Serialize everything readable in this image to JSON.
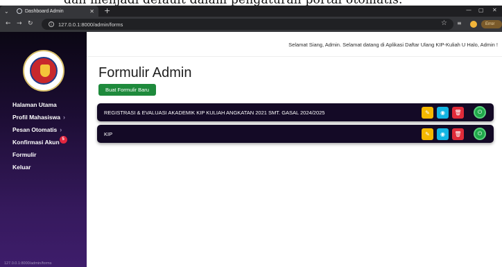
{
  "caption_fragment": "dan menjadi default dalam pengaturan portal otomatis.",
  "browser": {
    "tab_title": "Dashboard Admin",
    "url": "127.0.0.1:8000/admin/forms",
    "error_label": "Error"
  },
  "sidebar": {
    "items": [
      {
        "label": "Halaman Utama",
        "chevron": false
      },
      {
        "label": "Profil Mahasiswa",
        "chevron": true
      },
      {
        "label": "Pesan Otomatis",
        "chevron": true
      },
      {
        "label": "Konfirmasi Akun",
        "chevron": false,
        "badge": "5"
      },
      {
        "label": "Formulir",
        "chevron": false
      },
      {
        "label": "Keluar",
        "chevron": false
      }
    ],
    "status_url": "127.0.0.1:8000/admin/forms"
  },
  "header": {
    "greeting": "Selamat Siang, Admin. Selamat datang di Aplikasi Daftar Ulang KIP-Kuliah U Halo, Admin !"
  },
  "main": {
    "title": "Formulir Admin",
    "new_form_button": "Buat Formulir Baru",
    "forms": [
      {
        "name": "REGISTRASI & EVALUASI AKADEMIK KIP KULIAH ANGKATAN 2021 SMT. GASAL 2024/2025"
      },
      {
        "name": "KIP"
      }
    ]
  },
  "icons": {
    "edit": "pencil-icon",
    "view": "eye-icon",
    "delete": "trash-icon",
    "toggle": "power-icon"
  },
  "colors": {
    "sidebar_top": "#0b0714",
    "sidebar_bottom": "#3e1d6b",
    "row_bg": "#140a26",
    "primary_green": "#1e8a3c",
    "edit": "#f5b800",
    "view": "#13b5e3",
    "delete": "#e02b3a",
    "power": "#1fa84a"
  }
}
